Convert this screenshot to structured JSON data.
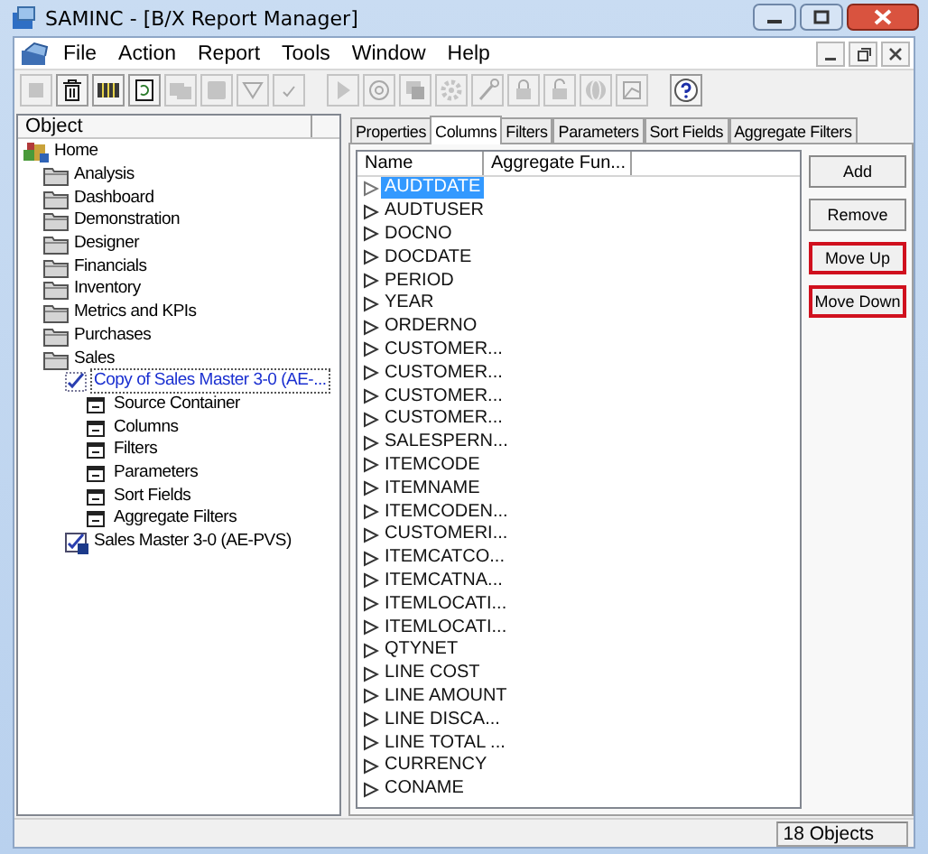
{
  "window": {
    "title": "SAMINC - [B/X Report Manager]"
  },
  "menu": [
    "File",
    "Action",
    "Report",
    "Tools",
    "Window",
    "Help"
  ],
  "toolbar": [
    {
      "kind": "square",
      "disabled": true
    },
    {
      "kind": "trash",
      "disabled": false
    },
    {
      "kind": "grid",
      "disabled": false
    },
    {
      "kind": "document",
      "disabled": false
    },
    {
      "kind": "copy",
      "disabled": true
    },
    {
      "kind": "paste",
      "disabled": true
    },
    {
      "kind": "filter",
      "disabled": true
    },
    {
      "kind": "check",
      "disabled": true
    },
    {
      "kind": "separator"
    },
    {
      "kind": "play",
      "disabled": true
    },
    {
      "kind": "at",
      "disabled": true
    },
    {
      "kind": "window",
      "disabled": true
    },
    {
      "kind": "gear",
      "disabled": true
    },
    {
      "kind": "wand",
      "disabled": true
    },
    {
      "kind": "lock",
      "disabled": true
    },
    {
      "kind": "unlock",
      "disabled": true
    },
    {
      "kind": "globe",
      "disabled": true
    },
    {
      "kind": "chart",
      "disabled": true
    },
    {
      "kind": "separator"
    },
    {
      "kind": "help",
      "disabled": false
    }
  ],
  "tree": {
    "header": "Object",
    "items": [
      {
        "label": "Home",
        "kind": "home",
        "selected": false,
        "children": [
          {
            "label": "Analysis",
            "kind": "folder",
            "selected": false
          },
          {
            "label": "Dashboard",
            "kind": "folder",
            "selected": false
          },
          {
            "label": "Demonstration",
            "kind": "folder",
            "selected": false
          },
          {
            "label": "Designer",
            "kind": "folder",
            "selected": false
          },
          {
            "label": "Financials",
            "kind": "folder",
            "selected": false
          },
          {
            "label": "Inventory",
            "kind": "folder",
            "selected": false
          },
          {
            "label": "Metrics and KPIs",
            "kind": "folder",
            "selected": false
          },
          {
            "label": "Purchases",
            "kind": "folder",
            "selected": false
          },
          {
            "label": "Sales",
            "kind": "folder",
            "selected": false,
            "children": [
              {
                "label": "Copy of Sales Master 3-0 (AE-...",
                "kind": "report",
                "selected": true,
                "children": [
                  {
                    "label": "Source Container",
                    "kind": "node",
                    "selected": false
                  },
                  {
                    "label": "Columns",
                    "kind": "node",
                    "selected": false
                  },
                  {
                    "label": "Filters",
                    "kind": "node",
                    "selected": false
                  },
                  {
                    "label": "Parameters",
                    "kind": "node",
                    "selected": false
                  },
                  {
                    "label": "Sort Fields",
                    "kind": "node",
                    "selected": false
                  },
                  {
                    "label": "Aggregate Filters",
                    "kind": "node",
                    "selected": false
                  }
                ]
              },
              {
                "label": "Sales Master 3-0 (AE-PVS)",
                "kind": "report_locked",
                "selected": false
              }
            ]
          }
        ]
      }
    ]
  },
  "tabs": [
    {
      "label": "Properties",
      "selected": false
    },
    {
      "label": "Columns",
      "selected": true
    },
    {
      "label": "Filters",
      "selected": false
    },
    {
      "label": "Parameters",
      "selected": false
    },
    {
      "label": "Sort Fields",
      "selected": false
    },
    {
      "label": "Aggregate Filters",
      "selected": false
    }
  ],
  "columns_list": {
    "headers": [
      "Name",
      "Aggregate Fun..."
    ],
    "rows": [
      {
        "name": "AUDTDATE",
        "selected": true
      },
      {
        "name": "AUDTUSER",
        "selected": false
      },
      {
        "name": "DOCNO",
        "selected": false
      },
      {
        "name": "DOCDATE",
        "selected": false
      },
      {
        "name": "PERIOD",
        "selected": false
      },
      {
        "name": "YEAR",
        "selected": false
      },
      {
        "name": "ORDERNO",
        "selected": false
      },
      {
        "name": "CUSTOMER...",
        "selected": false
      },
      {
        "name": "CUSTOMER...",
        "selected": false
      },
      {
        "name": "CUSTOMER...",
        "selected": false
      },
      {
        "name": "CUSTOMER...",
        "selected": false
      },
      {
        "name": "SALESPERN...",
        "selected": false
      },
      {
        "name": "ITEMCODE",
        "selected": false
      },
      {
        "name": "ITEMNAME",
        "selected": false
      },
      {
        "name": "ITEMCODEN...",
        "selected": false
      },
      {
        "name": "CUSTOMERI...",
        "selected": false
      },
      {
        "name": "ITEMCATCO...",
        "selected": false
      },
      {
        "name": "ITEMCATNA...",
        "selected": false
      },
      {
        "name": "ITEMLOCATI...",
        "selected": false
      },
      {
        "name": "ITEMLOCATI...",
        "selected": false
      },
      {
        "name": "QTYNET",
        "selected": false
      },
      {
        "name": "LINE COST",
        "selected": false
      },
      {
        "name": "LINE AMOUNT",
        "selected": false
      },
      {
        "name": "LINE DISCA...",
        "selected": false
      },
      {
        "name": "LINE TOTAL ...",
        "selected": false
      },
      {
        "name": "CURRENCY",
        "selected": false
      },
      {
        "name": "CONAME",
        "selected": false
      }
    ]
  },
  "buttons": [
    {
      "label": "Add",
      "highlighted": false
    },
    {
      "label": "Remove",
      "highlighted": false
    },
    {
      "label": "Move Up",
      "highlighted": true
    },
    {
      "label": "Move Down",
      "highlighted": true
    }
  ],
  "status_bar": {
    "count": "18 Objects"
  }
}
